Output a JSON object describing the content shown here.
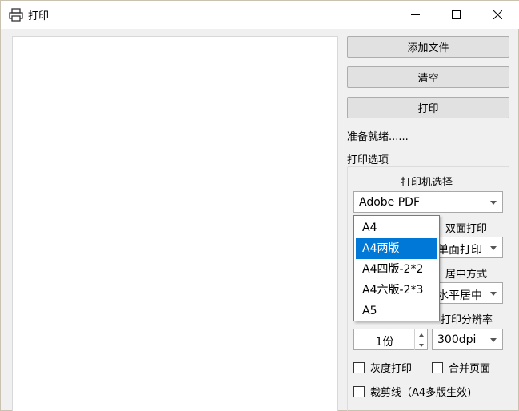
{
  "window": {
    "title": "打印"
  },
  "buttons": {
    "add_file": "添加文件",
    "clear": "清空",
    "print": "打印"
  },
  "status": "准备就绪......",
  "options": {
    "title": "打印选项",
    "printer_label": "打印机选择",
    "printer_value": "Adobe PDF",
    "layout_dropdown": {
      "items": [
        "A4",
        "A4两版",
        "A4四版-2*2",
        "A4六版-2*3",
        "A5"
      ],
      "highlighted": "A4两版"
    },
    "duplex_label": "双面打印",
    "duplex_value": "单面打印",
    "center_label": "居中方式",
    "center_value": "水平居中",
    "resolution_label": "打印分辨率",
    "resolution_value": "300dpi",
    "copies_value": "1份",
    "grayscale_label": "灰度打印",
    "merge_label": "合并页面",
    "crop_label": "裁剪线（A4多版生效)"
  },
  "colors": {
    "selection": "#0078d7"
  }
}
